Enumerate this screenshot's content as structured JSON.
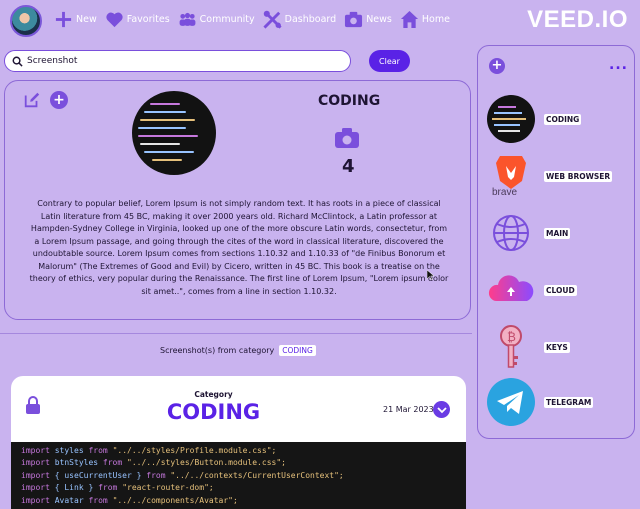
{
  "nav": {
    "items": [
      {
        "label": "New",
        "icon": "plus-icon"
      },
      {
        "label": "Favorites",
        "icon": "heart-icon"
      },
      {
        "label": "Community",
        "icon": "people-icon"
      },
      {
        "label": "Dashboard",
        "icon": "tools-icon"
      },
      {
        "label": "News",
        "icon": "camera-icon"
      },
      {
        "label": "Home",
        "icon": "home-icon"
      }
    ],
    "watermark": "VEED.IO"
  },
  "search": {
    "value": "Screenshot",
    "clear_label": "Clear"
  },
  "detail": {
    "title": "CODING",
    "count": "4",
    "description": "Contrary to popular belief, Lorem Ipsum is not simply random text. It has roots in a piece of classical Latin literature from 45 BC, making it over 2000 years old. Richard McClintock, a Latin professor at Hampden-Sydney College in Virginia, looked up one of the more obscure Latin words, consectetur, from a Lorem Ipsum passage, and going through the cites of the word in classical literature, discovered the undoubtable source. Lorem Ipsum comes from sections 1.10.32 and 1.10.33 of \"de Finibus Bonorum et Malorum\" (The Extremes of Good and Evil) by Cicero, written in 45 BC. This book is a treatise on the theory of ethics, very popular during the Renaissance. The first line of Lorem Ipsum, \"Lorem ipsum dolor sit amet..\", comes from a line in section 1.10.32."
  },
  "screenshots": {
    "label": "Screenshot(s) from category",
    "tag": "CODING"
  },
  "card": {
    "category_label": "Category",
    "category": "CODING",
    "date": "21 Mar 2023",
    "code_lines": [
      {
        "kw": "import",
        "id": "styles",
        "from": "from",
        "str": "\"../../styles/Profile.module.css\";"
      },
      {
        "kw": "import",
        "id": "btnStyles",
        "from": "from",
        "str": "\"../../styles/Button.module.css\";"
      },
      {
        "kw": "import",
        "id": "{ useCurrentUser }",
        "from": "from",
        "str": "\"../../contexts/CurrentUserContext\";"
      },
      {
        "kw": "import",
        "id": "{ Link }",
        "from": "from",
        "str": "\"react-router-dom\";"
      },
      {
        "kw": "import",
        "id": "Avatar",
        "from": "from",
        "str": "\"../../components/Avatar\";"
      }
    ]
  },
  "sidebar": {
    "items": [
      {
        "label": "CODING"
      },
      {
        "label": "WEB BROWSER",
        "thumb_text": "brave"
      },
      {
        "label": "MAIN"
      },
      {
        "label": "CLOUD"
      },
      {
        "label": "KEYS"
      },
      {
        "label": "TELEGRAM"
      }
    ]
  },
  "colors": {
    "accent": "#5a22e6",
    "icon": "#7a4fdc",
    "background": "#c9b3ef"
  }
}
